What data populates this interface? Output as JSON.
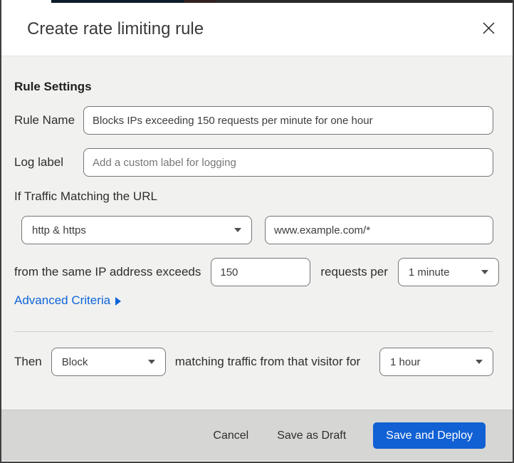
{
  "modal": {
    "title": "Create rate limiting rule"
  },
  "rule_settings": {
    "heading": "Rule Settings",
    "rule_name_label": "Rule Name",
    "rule_name_value": "Blocks IPs exceeding 150 requests per minute for one hour",
    "log_label_label": "Log label",
    "log_label_placeholder": "Add a custom label for logging"
  },
  "traffic": {
    "intro": "If Traffic Matching the URL",
    "scheme_selected": "http & https",
    "url_value": "www.example.com/*",
    "exceeds_text": "from the same IP address exceeds",
    "threshold_value": "150",
    "requests_per_text": "requests per",
    "period_selected": "1 minute",
    "advanced_label": "Advanced Criteria"
  },
  "action": {
    "then_label": "Then",
    "action_selected": "Block",
    "middle_text": "matching traffic from that visitor for",
    "duration_selected": "1 hour"
  },
  "footer": {
    "cancel_label": "Cancel",
    "save_draft_label": "Save as Draft",
    "save_deploy_label": "Save and Deploy"
  },
  "colors": {
    "primary_button": "#1160d4",
    "link_blue": "#0d65d9",
    "body_background": "#f1f1ef",
    "footer_background": "#d6d6d4",
    "input_border": "#767676"
  }
}
